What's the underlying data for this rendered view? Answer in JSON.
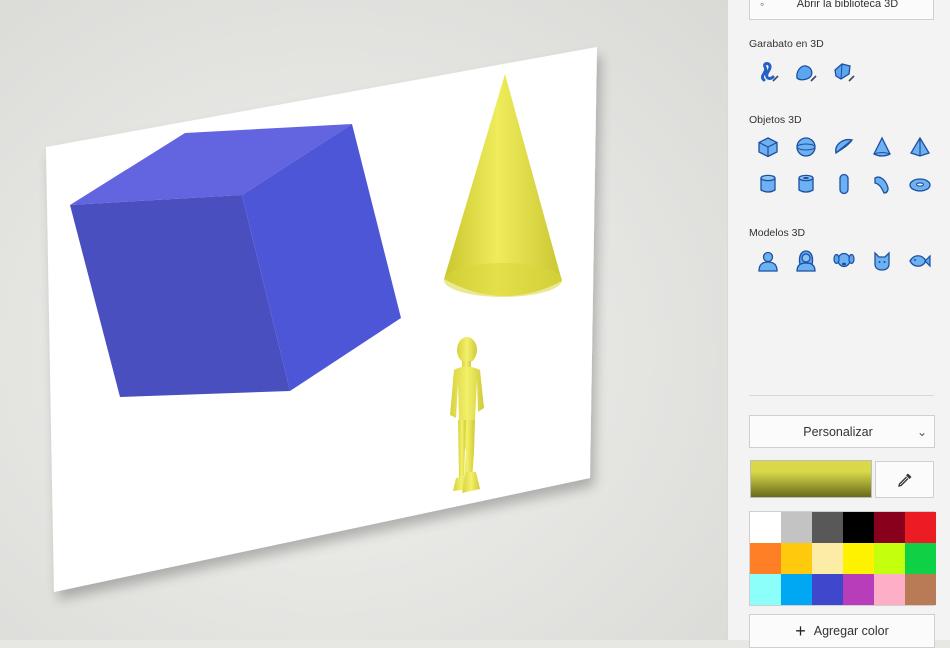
{
  "panel": {
    "library_button_label": "Abrir la biblioteca 3D",
    "library_icon": "library-3d-icon",
    "sections": [
      {
        "title": "Garabato en 3D",
        "icons": [
          "tube-doodle-icon",
          "soft-doodle-icon",
          "sharp-doodle-icon"
        ]
      },
      {
        "title": "Objetos 3D",
        "icons": [
          "cube-icon",
          "sphere-icon",
          "hemisphere-icon",
          "cone-icon",
          "pyramid-icon",
          "cylinder-icon",
          "tube-icon",
          "capsule-icon",
          "curved-tube-icon",
          "donut-icon"
        ]
      },
      {
        "title": "Modelos 3D",
        "icons": [
          "man-model-icon",
          "woman-model-icon",
          "dog-model-icon",
          "cat-model-icon",
          "fish-model-icon"
        ]
      }
    ],
    "material_dropdown": {
      "selected": "Personalizar",
      "icon": "chevron-down-icon"
    },
    "current_color_top": "#d8d84a",
    "current_color_bottom": "#6a6a1a",
    "eyedropper_icon": "eyedropper-icon",
    "palette": [
      "#ffffff",
      "#c3c3c3",
      "#585858",
      "#000000",
      "#88001b",
      "#ec1c24",
      "#ff7f27",
      "#ffc90e",
      "#fdeca6",
      "#fff200",
      "#c4ff0e",
      "#0ed145",
      "#8cfffb",
      "#00a8f3",
      "#3f48cc",
      "#b83dba",
      "#ffaec8",
      "#b97a56"
    ],
    "add_color_label": "Agregar color"
  },
  "scene": {
    "canvas_color": "#ffffff",
    "cube_colors": {
      "top": "#6264e0",
      "front": "#4a4fc0",
      "right": "#4e56d8"
    },
    "cone_color": "#e0e048",
    "figure_color": "#ece95c"
  }
}
